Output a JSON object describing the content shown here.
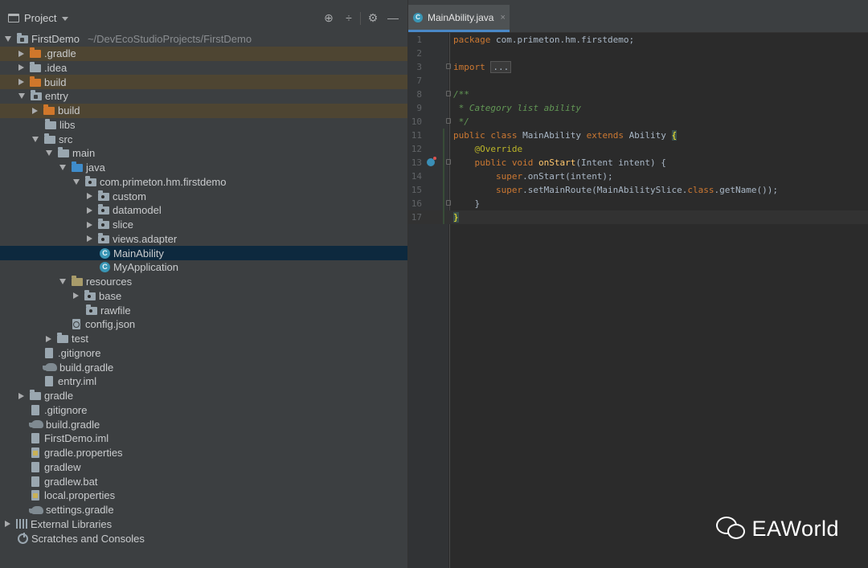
{
  "project_panel": {
    "title": "Project",
    "buttons": [
      "locate-icon",
      "collapse-icon",
      "gear-icon",
      "minimize-icon"
    ],
    "tree": [
      {
        "label": "FirstDemo",
        "path": "~/DevEcoStudioProjects/FirstDemo",
        "depth": 0,
        "arrow": "down",
        "icon": "module-folder",
        "state": ""
      },
      {
        "label": ".gradle",
        "depth": 1,
        "arrow": "right",
        "icon": "orange-folder",
        "state": "excluded"
      },
      {
        "label": ".idea",
        "depth": 1,
        "arrow": "right",
        "icon": "folder",
        "state": ""
      },
      {
        "label": "build",
        "depth": 1,
        "arrow": "right",
        "icon": "orange-folder",
        "state": "excluded"
      },
      {
        "label": "entry",
        "depth": 1,
        "arrow": "down",
        "icon": "module-folder",
        "state": ""
      },
      {
        "label": "build",
        "depth": 2,
        "arrow": "right",
        "icon": "orange-folder",
        "state": "excluded"
      },
      {
        "label": "libs",
        "depth": 2,
        "arrow": "none",
        "icon": "folder",
        "state": ""
      },
      {
        "label": "src",
        "depth": 2,
        "arrow": "down",
        "icon": "folder",
        "state": ""
      },
      {
        "label": "main",
        "depth": 3,
        "arrow": "down",
        "icon": "folder",
        "state": ""
      },
      {
        "label": "java",
        "depth": 4,
        "arrow": "down",
        "icon": "blue-folder",
        "state": ""
      },
      {
        "label": "com.primeton.hm.firstdemo",
        "depth": 5,
        "arrow": "down",
        "icon": "package-folder",
        "state": ""
      },
      {
        "label": "custom",
        "depth": 6,
        "arrow": "right",
        "icon": "package-folder",
        "state": ""
      },
      {
        "label": "datamodel",
        "depth": 6,
        "arrow": "right",
        "icon": "package-folder",
        "state": ""
      },
      {
        "label": "slice",
        "depth": 6,
        "arrow": "right",
        "icon": "package-folder",
        "state": ""
      },
      {
        "label": "views.adapter",
        "depth": 6,
        "arrow": "right",
        "icon": "package-folder",
        "state": ""
      },
      {
        "label": "MainAbility",
        "depth": 6,
        "arrow": "none",
        "icon": "class",
        "state": "selected"
      },
      {
        "label": "MyApplication",
        "depth": 6,
        "arrow": "none",
        "icon": "class",
        "state": ""
      },
      {
        "label": "resources",
        "depth": 4,
        "arrow": "down",
        "icon": "resources-folder",
        "state": ""
      },
      {
        "label": "base",
        "depth": 5,
        "arrow": "right",
        "icon": "package-folder",
        "state": ""
      },
      {
        "label": "rawfile",
        "depth": 5,
        "arrow": "none",
        "icon": "package-folder",
        "state": ""
      },
      {
        "label": "config.json",
        "depth": 4,
        "arrow": "none",
        "icon": "json-file",
        "state": ""
      },
      {
        "label": "test",
        "depth": 3,
        "arrow": "right",
        "icon": "folder",
        "state": ""
      },
      {
        "label": ".gitignore",
        "depth": 2,
        "arrow": "none",
        "icon": "file",
        "state": ""
      },
      {
        "label": "build.gradle",
        "depth": 2,
        "arrow": "none",
        "icon": "gradle",
        "state": ""
      },
      {
        "label": "entry.iml",
        "depth": 2,
        "arrow": "none",
        "icon": "file",
        "state": ""
      },
      {
        "label": "gradle",
        "depth": 1,
        "arrow": "right",
        "icon": "folder",
        "state": ""
      },
      {
        "label": ".gitignore",
        "depth": 1,
        "arrow": "none",
        "icon": "file",
        "state": ""
      },
      {
        "label": "build.gradle",
        "depth": 1,
        "arrow": "none",
        "icon": "gradle",
        "state": ""
      },
      {
        "label": "FirstDemo.iml",
        "depth": 1,
        "arrow": "none",
        "icon": "file",
        "state": ""
      },
      {
        "label": "gradle.properties",
        "depth": 1,
        "arrow": "none",
        "icon": "properties-file",
        "state": ""
      },
      {
        "label": "gradlew",
        "depth": 1,
        "arrow": "none",
        "icon": "file",
        "state": ""
      },
      {
        "label": "gradlew.bat",
        "depth": 1,
        "arrow": "none",
        "icon": "file",
        "state": ""
      },
      {
        "label": "local.properties",
        "depth": 1,
        "arrow": "none",
        "icon": "properties-file",
        "state": ""
      },
      {
        "label": "settings.gradle",
        "depth": 1,
        "arrow": "none",
        "icon": "gradle",
        "state": ""
      },
      {
        "label": "External Libraries",
        "depth": 0,
        "arrow": "right",
        "icon": "libraries",
        "state": ""
      },
      {
        "label": "Scratches and Consoles",
        "depth": 0,
        "arrow": "none",
        "icon": "scratches",
        "state": ""
      }
    ]
  },
  "editor": {
    "tab_label": "MainAbility.java",
    "tab_close": "×",
    "lines": [
      {
        "num": "1",
        "fold": false,
        "tokens": [
          [
            "kw",
            "package "
          ],
          [
            "plain",
            "com.primeton.hm.firstdemo;"
          ]
        ]
      },
      {
        "num": "2",
        "fold": false,
        "tokens": []
      },
      {
        "num": "3",
        "fold": true,
        "tokens": [
          [
            "kw",
            "import "
          ],
          [
            "ellipsis",
            "..."
          ]
        ]
      },
      {
        "num": "7",
        "fold": false,
        "tokens": []
      },
      {
        "num": "8",
        "fold": true,
        "tokens": [
          [
            "cmt",
            "/**"
          ]
        ]
      },
      {
        "num": "9",
        "fold": false,
        "tokens": [
          [
            "cmt",
            " * Category list ability"
          ]
        ]
      },
      {
        "num": "10",
        "fold": true,
        "tokens": [
          [
            "cmt",
            " */"
          ]
        ]
      },
      {
        "num": "11",
        "fold": false,
        "tokens": [
          [
            "kw",
            "public class "
          ],
          [
            "plain",
            "MainAbility "
          ],
          [
            "kw",
            "extends "
          ],
          [
            "plain",
            "Ability "
          ],
          [
            "brace",
            "{"
          ]
        ]
      },
      {
        "num": "12",
        "fold": false,
        "tokens": [
          [
            "ann",
            "    @Override"
          ]
        ]
      },
      {
        "num": "13",
        "fold": true,
        "mark": true,
        "tokens": [
          [
            "kw",
            "    public void "
          ],
          [
            "fn",
            "onStart"
          ],
          [
            "plain",
            "(Intent intent) {"
          ]
        ]
      },
      {
        "num": "14",
        "fold": false,
        "tokens": [
          [
            "kw",
            "        super"
          ],
          [
            "plain",
            "."
          ],
          [
            "plain",
            "onStart(intent);"
          ]
        ]
      },
      {
        "num": "15",
        "fold": false,
        "tokens": [
          [
            "kw",
            "        super"
          ],
          [
            "plain",
            ".setMainRoute(MainAbilitySlice."
          ],
          [
            "kw",
            "class"
          ],
          [
            "plain",
            ".getName());"
          ]
        ]
      },
      {
        "num": "16",
        "fold": true,
        "tokens": [
          [
            "plain",
            "    }"
          ]
        ]
      },
      {
        "num": "17",
        "fold": false,
        "current": true,
        "tokens": [
          [
            "brace",
            "}"
          ]
        ]
      }
    ]
  },
  "watermark": {
    "text": "EAWorld",
    "icon": "wechat-icon"
  }
}
